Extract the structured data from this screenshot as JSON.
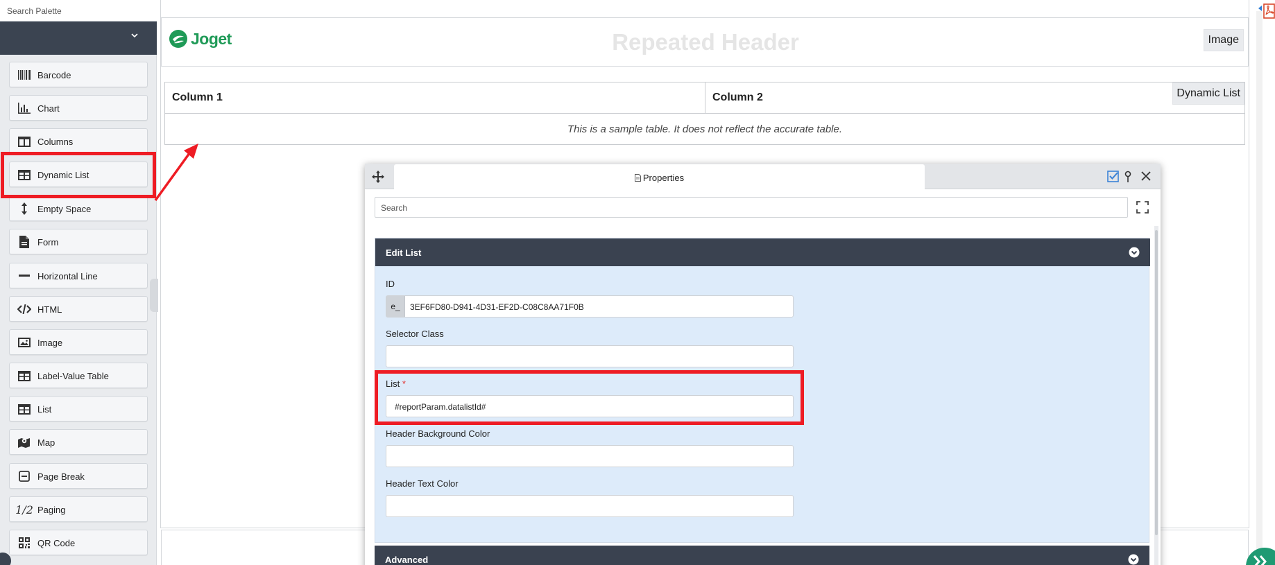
{
  "palette": {
    "search_placeholder": "Search Palette",
    "items": [
      {
        "label": "Barcode",
        "icon": "barcode-icon"
      },
      {
        "label": "Chart",
        "icon": "chart-icon"
      },
      {
        "label": "Columns",
        "icon": "columns-icon"
      },
      {
        "label": "Dynamic List",
        "icon": "table-icon"
      },
      {
        "label": "Empty Space",
        "icon": "vertical-arrows-icon"
      },
      {
        "label": "Form",
        "icon": "document-icon"
      },
      {
        "label": "Horizontal Line",
        "icon": "minus-icon"
      },
      {
        "label": "HTML",
        "icon": "code-icon"
      },
      {
        "label": "Image",
        "icon": "image-icon"
      },
      {
        "label": "Label-Value Table",
        "icon": "table-icon"
      },
      {
        "label": "List",
        "icon": "table-icon"
      },
      {
        "label": "Map",
        "icon": "map-icon"
      },
      {
        "label": "Page Break",
        "icon": "page-break-icon"
      },
      {
        "label": "Paging",
        "icon": "fraction-icon"
      },
      {
        "label": "QR Code",
        "icon": "qr-code-icon"
      }
    ],
    "paging_icon_text": "1/2"
  },
  "canvas": {
    "logo_text": "Joget",
    "header_title": "Repeated Header",
    "image_badge": "Image",
    "table": {
      "column1": "Column 1",
      "column2": "Column 2",
      "badge": "Dynamic List",
      "note": "This is a sample table. It does not reflect the accurate table."
    }
  },
  "dialog": {
    "tab_title": "Properties",
    "search_placeholder": "Search",
    "section_title": "Edit List",
    "fields": {
      "id_label": "ID",
      "id_prefix": "e_",
      "id_value": "3EF6FD80-D941-4D31-EF2D-C08C8AA71F0B",
      "selector_label": "Selector Class",
      "selector_value": "",
      "list_label": "List",
      "list_required": "*",
      "list_value": "#reportParam.datalistId#",
      "header_bg_label": "Header Background Color",
      "header_bg_value": "",
      "header_text_label": "Header Text Color",
      "header_text_value": ""
    },
    "advanced_title": "Advanced"
  },
  "colors": {
    "annotation_red": "#ee1c24",
    "section_dark": "#3a4250",
    "section_bg": "#ddebfa",
    "brand_green": "#1f9a57"
  }
}
